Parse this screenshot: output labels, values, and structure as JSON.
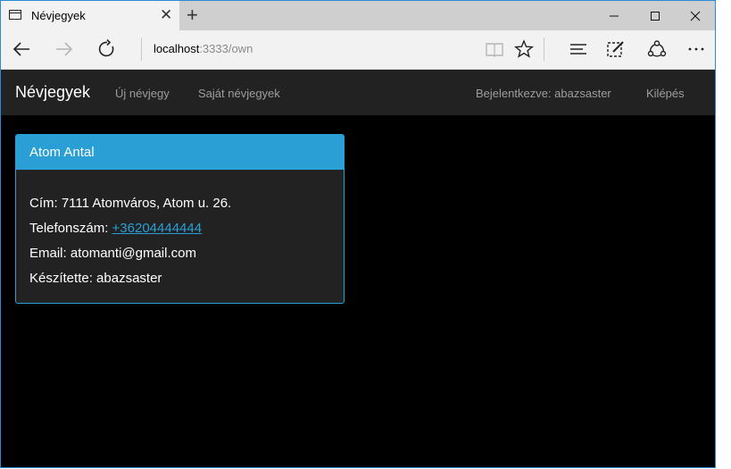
{
  "browser": {
    "tab_title": "Névjegyek",
    "address_host": "localhost",
    "address_path": ":3333/own"
  },
  "site": {
    "brand": "Névjegyek",
    "nav": {
      "new_contact": "Új névjegy",
      "own_contacts": "Saját névjegyek",
      "logged_in": "Bejelentkezve: abazsaster",
      "logout": "Kilépés"
    }
  },
  "card": {
    "title": "Atom Antal",
    "address_label": "Cím:",
    "address_value": "7111 Atomváros, Atom u. 26.",
    "phone_label": "Telefonszám:",
    "phone_value": "+36204444444",
    "email_label": "Email:",
    "email_value": "atomanti@gmail.com",
    "creator_label": "Készítette:",
    "creator_value": "abazsaster"
  },
  "colors": {
    "accent": "#2a9fd6",
    "navbar": "#222222",
    "background": "#000000"
  }
}
